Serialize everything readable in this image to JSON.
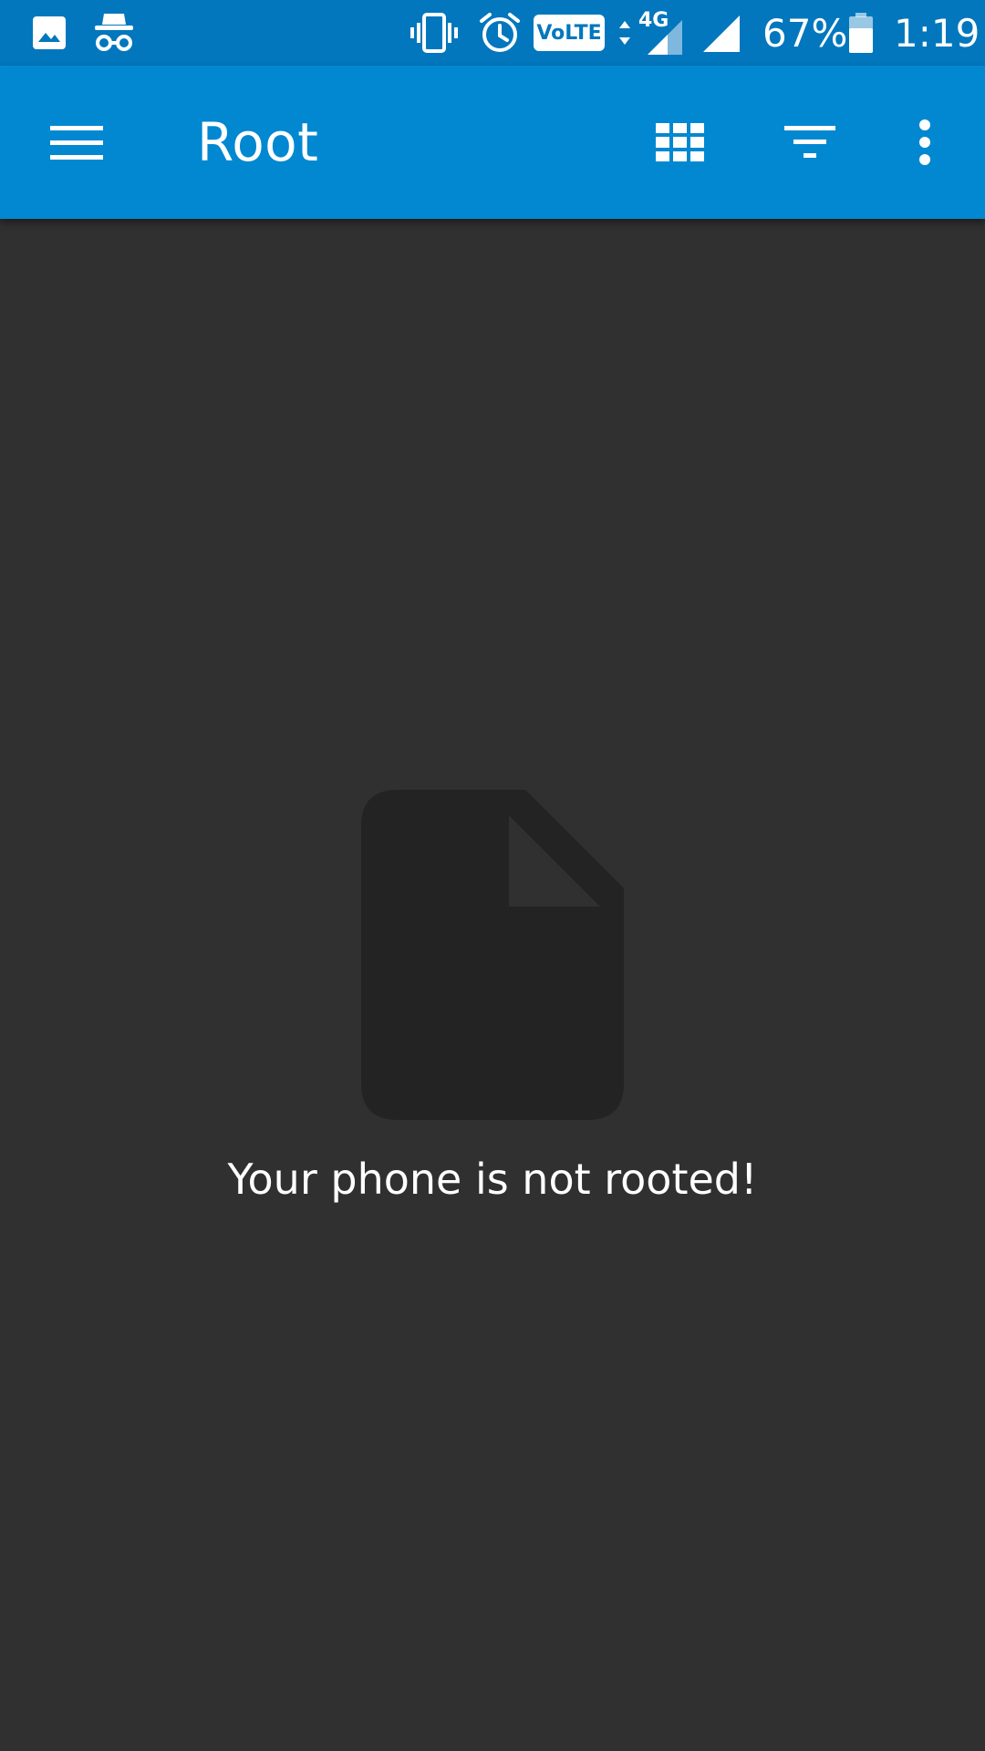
{
  "status_bar": {
    "left_icons": [
      "image-icon",
      "incognito-icon"
    ],
    "right_icons": [
      "vibrate-icon",
      "alarm-icon",
      "volte-icon",
      "data-arrows-icon",
      "signal-4g-icon",
      "signal-icon",
      "battery-icon"
    ],
    "volte_label": "VoLTE",
    "network_type": "4G",
    "battery_percent": "67%",
    "battery_level": 0.67,
    "time": "1:19"
  },
  "app_bar": {
    "menu_icon": "menu-icon",
    "title": "Root",
    "actions": [
      {
        "name": "grid-view-icon"
      },
      {
        "name": "filter-icon"
      },
      {
        "name": "more-options-icon"
      }
    ],
    "background": "#0288d1"
  },
  "status_bar_color": "#0277bd",
  "content": {
    "empty_state_icon": "file-icon",
    "message": "Your phone is not rooted!",
    "background": "#303030"
  }
}
